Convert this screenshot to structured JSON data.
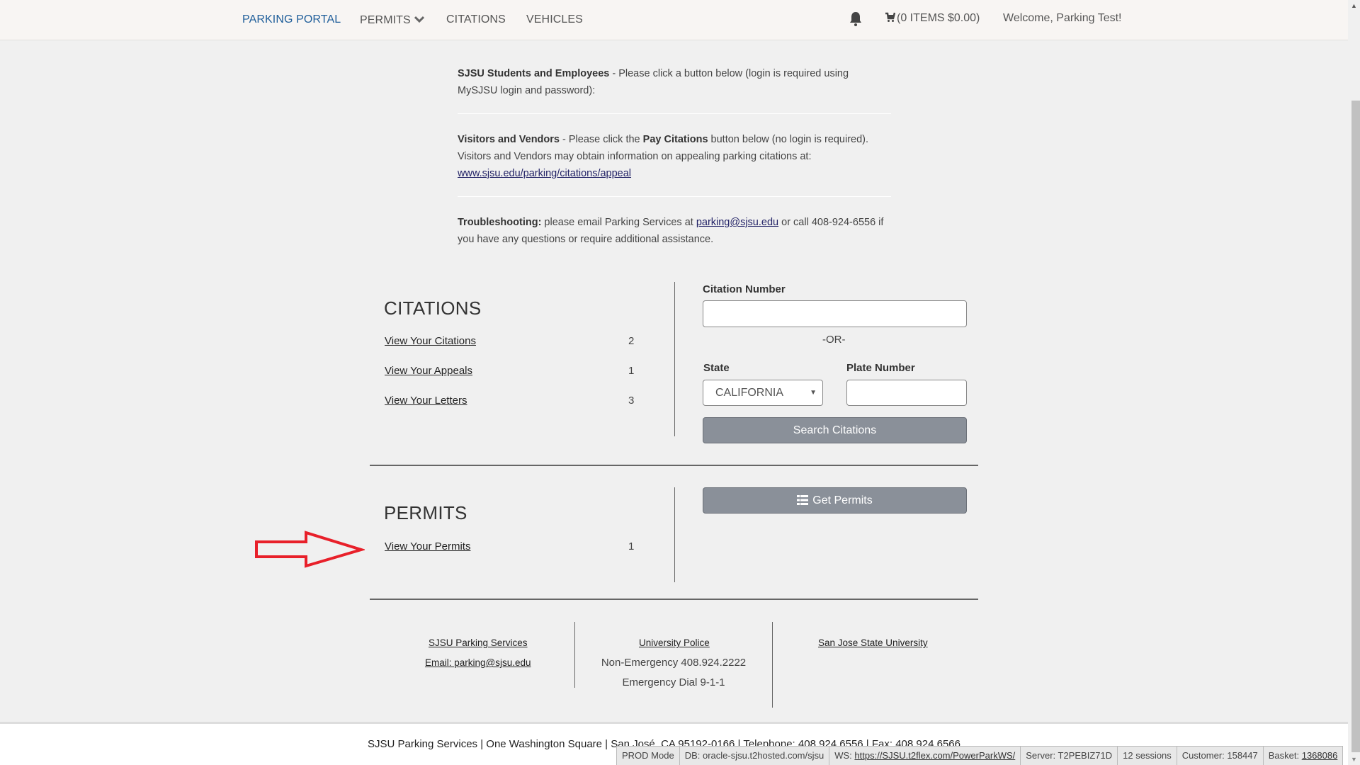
{
  "nav": {
    "items": [
      {
        "label": "PARKING PORTAL",
        "active": true
      },
      {
        "label": "PERMITS",
        "dropdown": true
      },
      {
        "label": "CITATIONS"
      },
      {
        "label": "VEHICLES"
      }
    ],
    "bell_icon": "bell-icon",
    "cart": {
      "icon": "shopping-cart-icon",
      "label": "(0 ITEMS $0.00)"
    },
    "welcome": "Welcome, Parking Test!",
    "colors": {
      "active": "#1f5e9a",
      "navbar_bg": "#f8f5f3"
    }
  },
  "intro": {
    "students_bold": "SJSU Students and Employees",
    "students_text": " - Please click a button below (login is required using MySJSU login and password):",
    "visitors_bold": "Visitors and Vendors",
    "visitors_text1": " - Please click the ",
    "visitors_bold2": "Pay Citations",
    "visitors_text2": " button below (no login is required).  Visitors and Vendors may obtain information on appealing parking citations at: ",
    "visitors_link": "www.sjsu.edu/parking/citations/appeal",
    "trouble_bold": "Troubleshooting:",
    "trouble_text1": " please email Parking Services at ",
    "trouble_link": "parking@sjsu.edu",
    "trouble_text2": " or call 408-924-6556 if you have any questions or require additional assistance."
  },
  "citations": {
    "title": "CITATIONS",
    "rows": [
      {
        "label": "View Your Citations",
        "count": "2"
      },
      {
        "label": "View Your Appeals",
        "count": "1"
      },
      {
        "label": "View Your Letters",
        "count": "3"
      }
    ],
    "search": {
      "citation_label": "Citation Number",
      "citation_value": "",
      "or_text": "-OR-",
      "state_label": "State",
      "state_value": "CALIFORNIA",
      "plate_label": "Plate Number",
      "plate_value": "",
      "button": "Search Citations"
    }
  },
  "permits": {
    "title": "PERMITS",
    "rows": [
      {
        "label": "View Your Permits",
        "count": "1"
      }
    ],
    "get_button": "Get Permits",
    "get_icon": "list-icon"
  },
  "annotation": {
    "type": "red-arrow",
    "color": "#e8202a",
    "points_to": "View Your Permits"
  },
  "footer_links": {
    "col1": {
      "title": "SJSU Parking Services",
      "email": "Email: parking@sjsu.edu"
    },
    "col2": {
      "title": "University Police",
      "line1": "Non-Emergency 408.924.2222",
      "line2": "Emergency Dial 9-1-1"
    },
    "col3": {
      "title": "San Jose State University"
    }
  },
  "bottom_footer": {
    "address": "SJSU Parking Services | One Washington Square | San José, CA  95192-0166 | Telephone: 408.924.6556 | Fax: 408.924.6566"
  },
  "devbar": {
    "mode": "PROD Mode",
    "db": "DB: oracle-sjsu.t2hosted.com/sjsu",
    "ws_label": "WS: ",
    "ws_link": "https://SJSU.t2flex.com/PowerParkWS/",
    "server": "Server: T2PEBIZ71D",
    "sessions": "12 sessions",
    "customer": "Customer: 158447",
    "basket_label": "Basket: ",
    "basket_link": "1368086"
  }
}
